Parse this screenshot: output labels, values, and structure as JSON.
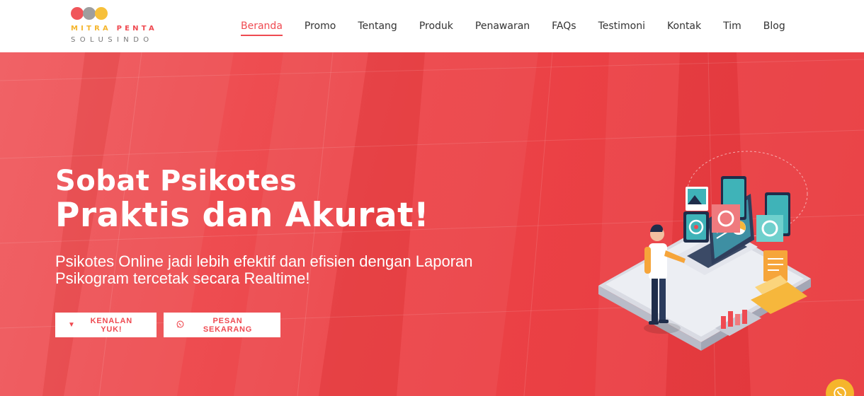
{
  "logo": {
    "word1": "MITRA",
    "word2": "PENTA",
    "word3": "SOLUSINDO"
  },
  "nav": [
    {
      "label": "Beranda",
      "active": true
    },
    {
      "label": "Promo"
    },
    {
      "label": "Tentang"
    },
    {
      "label": "Produk"
    },
    {
      "label": "Penawaran"
    },
    {
      "label": "FAQs"
    },
    {
      "label": "Testimoni"
    },
    {
      "label": "Kontak"
    },
    {
      "label": "Tim"
    },
    {
      "label": "Blog"
    }
  ],
  "hero": {
    "title_line1": "Sobat Psikotes",
    "title_line2": "Praktis dan Akurat!",
    "subtitle": "Psikotes Online jadi lebih efektif dan efisien dengan Laporan Psikogram tercetak secara Realtime!",
    "btn_primary": "KENALAN YUK!",
    "btn_primary_icon": "caret-down-icon",
    "btn_secondary": "PESAN SEKARANG",
    "btn_secondary_icon": "whatsapp-icon"
  },
  "colors": {
    "accent": "#ef4a51",
    "hero_bg": "#ec4448",
    "logo_yellow": "#f5b52c",
    "logo_gray": "#9e9e9e",
    "logo_red": "#f0555a"
  },
  "floating": {
    "icon": "whatsapp-icon"
  }
}
